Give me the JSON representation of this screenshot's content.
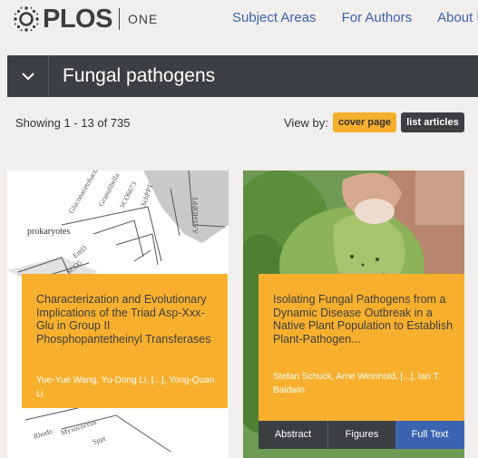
{
  "header": {
    "logo_text": "PLOS",
    "logo_sub": "ONE",
    "nav": [
      "Subject Areas",
      "For Authors",
      "About Us"
    ]
  },
  "banner": {
    "title": "Fungal pathogens"
  },
  "results": {
    "showing": "Showing 1 - 13 of 735",
    "view_by": "View by:",
    "cover_page": "cover page",
    "list_articles": "list articles"
  },
  "cards": [
    {
      "title": "Characterization and Evolutionary Implications of the Triad Asp-Xxx-Glu in Group II Phosphopantetheinyl Transferases",
      "authors": "Yue-Yue Wang, Yu-Dong Li, [...], Yong-Quan Li",
      "figure_labels": [
        "Gluconacetobacter",
        "Granulibella",
        "SCO6673",
        "SchPPT",
        "prokaryotes",
        "EntD",
        "SCO5",
        "AASHDPPT",
        "Myxococcus",
        "Sppt",
        "Rhodo"
      ]
    },
    {
      "title": "Isolating Fungal Pathogens from a Dynamic Disease Outbreak in a Native Plant Population to Establish Plant-Pathogen...",
      "authors": "Stefan Schuck, Arne Weinhold, [...], Ian T. Baldwin",
      "actions": {
        "abstract": "Abstract",
        "figures": "Figures",
        "full_text": "Full Text"
      }
    }
  ],
  "colors": {
    "accent": "#f8af2d",
    "dark": "#3c3f41",
    "link": "#3c63af"
  }
}
